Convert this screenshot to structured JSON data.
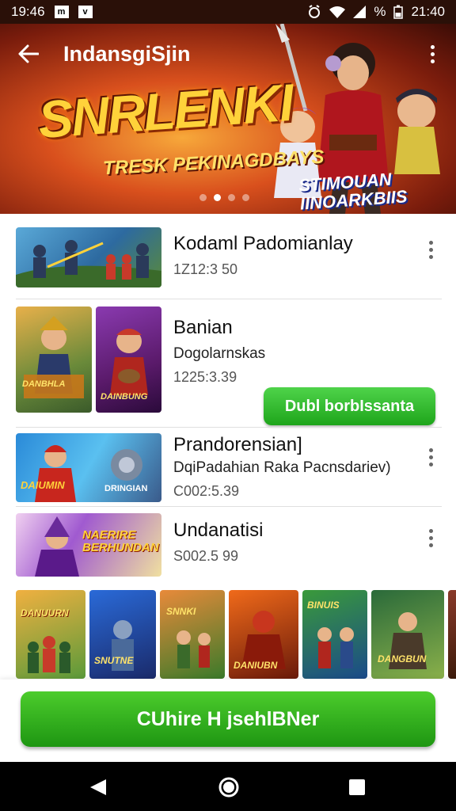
{
  "status_bar": {
    "time": "19:46",
    "icon_a": "m",
    "icon_b": "v",
    "battery_text": "%",
    "right_time": "21:40"
  },
  "header": {
    "title": "IndansgiSjin",
    "back_icon": "arrow-left-icon",
    "menu_icon": "more-vert-icon"
  },
  "hero": {
    "logo_main": "SNRLENKI",
    "logo_sub": "TRESK PEKINAGDBAYS",
    "badge_line1": "STIMOUAN",
    "badge_line2": "IINOARKBIIS",
    "dots_total": 4,
    "active_dot": 1
  },
  "items": [
    {
      "title": "Kodaml Padomianlay",
      "meta": "1Z12:3 50"
    },
    {
      "title": "Banian",
      "subtitle": "Dogolarnskas",
      "meta": "1225:3.39",
      "button": "Dubl borbIssanta"
    },
    {
      "title": "Prandorensian]",
      "subtitle": "DqiPadahian Raka Pacnsdariev)",
      "meta": "C002:5.39"
    },
    {
      "title": "Undanatisi",
      "meta": "S002.5 99"
    }
  ],
  "thumb_labels": {
    "item2_left": "DANBHLA",
    "item2_right": "DAINBUNG",
    "item3_left": "DAIUMIN",
    "item3_right": "DRINGIAN",
    "item4": "NAERIRE BERHUNDAN"
  },
  "strip_labels": [
    "DANUURN",
    "SNUTNE",
    "SNNKI",
    "DANIUBN",
    "BINUIS",
    "DANGBUN"
  ],
  "cta": {
    "label": "CUhire H jsehlBNer"
  },
  "nav": {
    "back_icon": "nav-back-icon",
    "home_icon": "nav-home-icon",
    "recents_icon": "nav-recents-icon"
  },
  "colors": {
    "accent_green": "#1ea51b",
    "hero_orange": "#d9501d",
    "logo_yellow": "#ffd23a"
  }
}
